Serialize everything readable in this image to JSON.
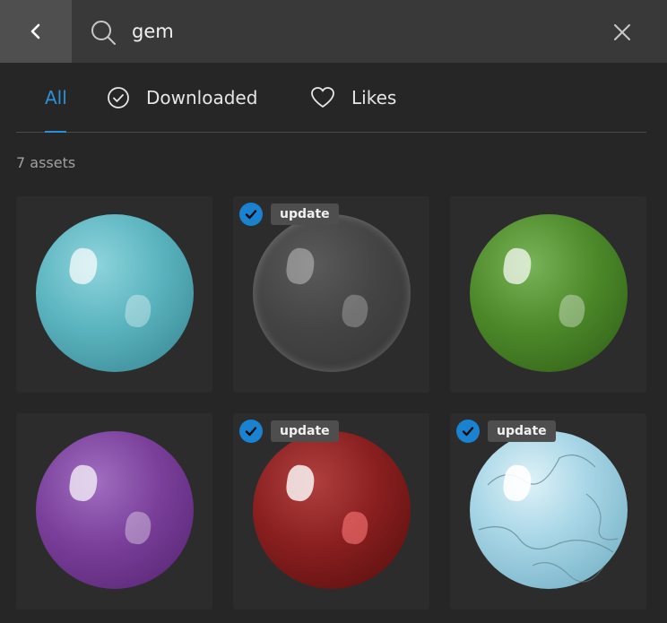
{
  "search": {
    "query": "gem",
    "back_icon": "chevron-left-icon",
    "search_icon": "search-icon",
    "clear_icon": "close-icon"
  },
  "tabs": [
    {
      "label": "All",
      "active": true,
      "icon": ""
    },
    {
      "label": "Downloaded",
      "active": false,
      "icon": "check-circle-icon"
    },
    {
      "label": "Likes",
      "active": false,
      "icon": "heart-icon"
    }
  ],
  "asset_count": "7 assets",
  "colors": {
    "accent": "#2f8fd6",
    "check": "#1a82cf"
  },
  "assets": [
    {
      "badge": "",
      "downloaded": false,
      "color": "#5ab4bf"
    },
    {
      "badge": "update",
      "downloaded": true,
      "color": "#9a9a9a"
    },
    {
      "badge": "",
      "downloaded": false,
      "color": "#4d8a2a"
    },
    {
      "badge": "",
      "downloaded": false,
      "color": "#7a3f9a"
    },
    {
      "badge": "update",
      "downloaded": true,
      "color": "#8a1f1f"
    },
    {
      "badge": "update",
      "downloaded": true,
      "color": "#a8d6e6"
    }
  ]
}
